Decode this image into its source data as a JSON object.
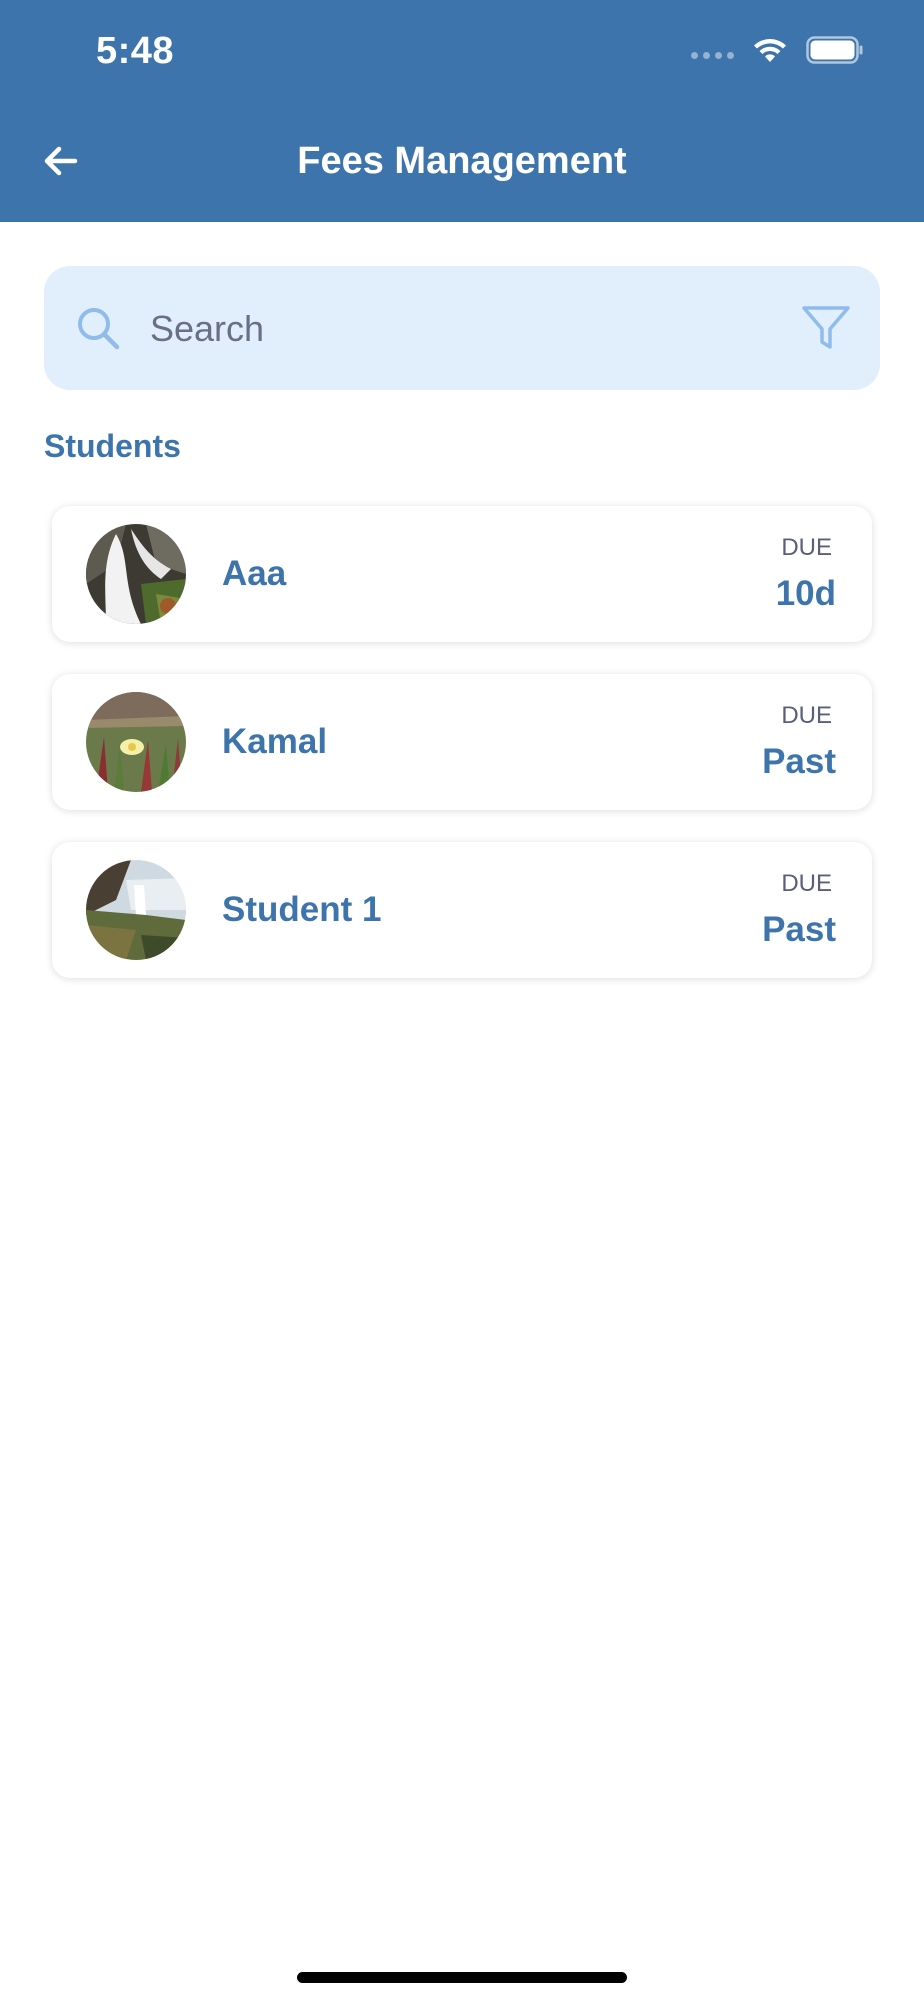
{
  "status_bar": {
    "time": "5:48"
  },
  "header": {
    "title": "Fees Management"
  },
  "search": {
    "placeholder": "Search",
    "value": ""
  },
  "section": {
    "title": "Students"
  },
  "students": [
    {
      "name": "Aaa",
      "due_label": "DUE",
      "due_value": "10d"
    },
    {
      "name": "Kamal",
      "due_label": "DUE",
      "due_value": "Past"
    },
    {
      "name": "Student 1",
      "due_label": "DUE",
      "due_value": "Past"
    }
  ],
  "colors": {
    "header_bg": "#3D74AB",
    "accent": "#3D74AB",
    "search_bg": "#E1EEFC",
    "icon_light": "#8FBCEB",
    "muted_text": "#585F78"
  },
  "icons": {
    "back": "arrow-left-icon",
    "search": "search-icon",
    "filter": "filter-icon",
    "wifi": "wifi-icon",
    "battery": "battery-icon"
  }
}
